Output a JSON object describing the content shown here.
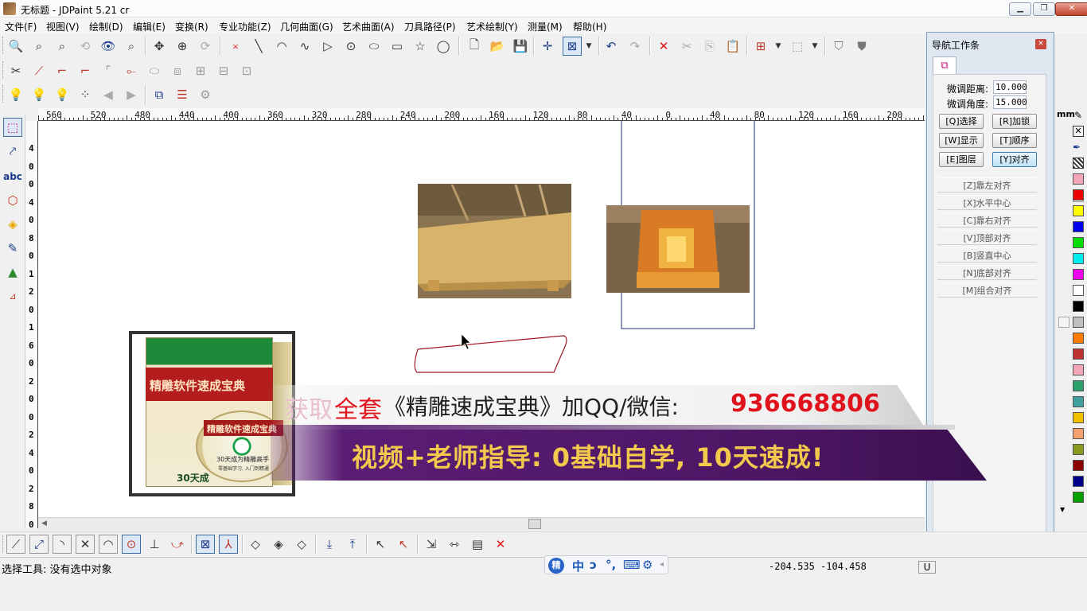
{
  "window": {
    "title": "无标题 - JDPaint 5.21 cr",
    "controls": [
      "minimize",
      "maximize",
      "close"
    ]
  },
  "menu": [
    "文件(F)",
    "视图(V)",
    "绘制(D)",
    "编辑(E)",
    "变换(R)",
    "专业功能(Z)",
    "几何曲面(G)",
    "艺术曲面(A)",
    "刀具路径(P)",
    "艺术绘制(Y)",
    "测量(M)",
    "帮助(H)"
  ],
  "ruler": {
    "unit": "mm",
    "h_ticks": [
      "560",
      "520",
      "480",
      "440",
      "400",
      "360",
      "320",
      "280",
      "240",
      "200",
      "160",
      "120",
      "80",
      "40",
      "0",
      "40",
      "80",
      "120",
      "160",
      "200"
    ],
    "v_ticks": [
      "4",
      "0",
      "0",
      "4",
      "0",
      "8",
      "0",
      "1",
      "2",
      "0",
      "1",
      "6",
      "0",
      "2",
      "0",
      "0",
      "2",
      "4",
      "0",
      "2",
      "8",
      "0"
    ]
  },
  "nav_panel": {
    "title": "导航工作条",
    "fine_distance_label": "微调距离:",
    "fine_distance_value": "10.000",
    "fine_angle_label": "微调角度:",
    "fine_angle_value": "15.000",
    "buttons": [
      "[Q]选择",
      "[R]加锁",
      "[W]显示",
      "[T]顺序",
      "[E]图层",
      "[Y]对齐"
    ],
    "align_buttons": [
      "[Z]靠左对齐",
      "[X]水平中心",
      "[C]靠右对齐",
      "[V]顶部对齐",
      "[B]竖直中心",
      "[N]底部对齐",
      "[M]组合对齐"
    ]
  },
  "palette": [
    "#f4a7b9",
    "#ee0000",
    "#ffff00",
    "#0000ee",
    "#00dd00",
    "#00eeee",
    "#ee00ee",
    "#ffffff",
    "#000000",
    "#c0c0c0",
    "#ff7a00",
    "#c03030",
    "#f4a7b9",
    "#2ca06a",
    "#40a0a0",
    "#f0c000",
    "#f4a070",
    "#8a9a20",
    "#8b0000",
    "#00008b",
    "#00a000"
  ],
  "status": {
    "message": "选择工具: 没有选中对象",
    "coords": "-204.535 -104.458",
    "indicator": "U"
  },
  "ad": {
    "book_title": "精雕软件速成宝典",
    "cd_title": "精雕软件速成宝典",
    "cd_sub": "30天成为精雕高手",
    "cd_sub2": "零基础学习, 入门到精通",
    "book_foot": "30天成",
    "line1_a": "获取",
    "line1_b": "全套",
    "line1_c": "《精雕速成宝典》加QQ/微信:",
    "line1_num": "936668806",
    "line2": "视频+老师指导: 0基础自学, 10天速成!"
  },
  "ime": [
    "中",
    "ↄ",
    "°,",
    "⌨",
    "⚙"
  ]
}
